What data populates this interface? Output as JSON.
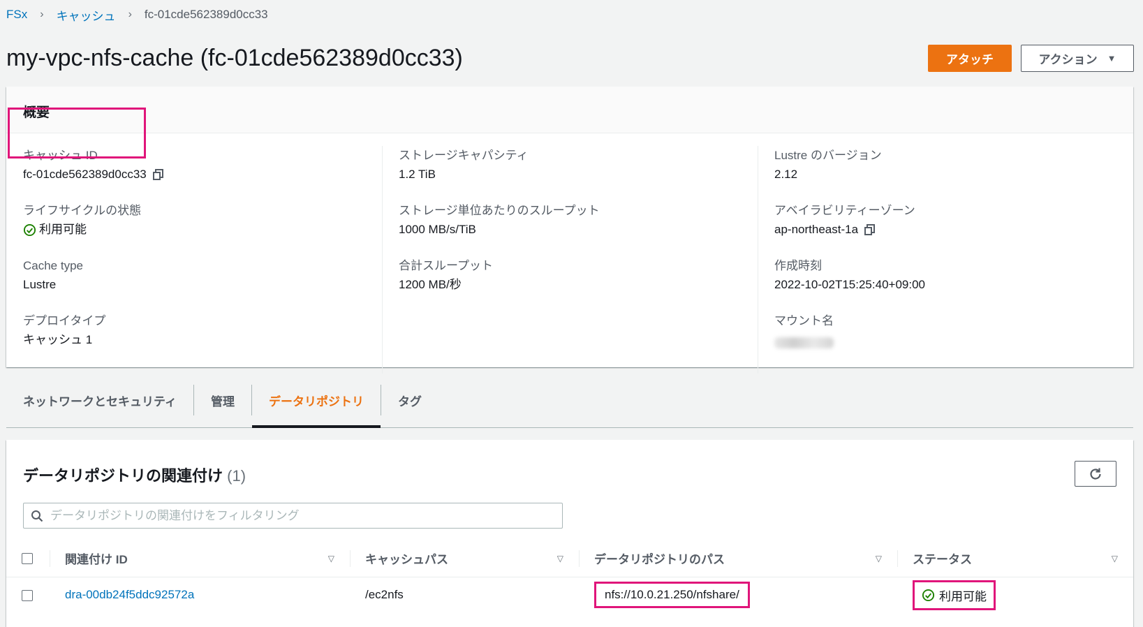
{
  "breadcrumb": {
    "items": [
      "FSx",
      "キャッシュ"
    ],
    "current": "fc-01cde562389d0cc33"
  },
  "page": {
    "title": "my-vpc-nfs-cache (fc-01cde562389d0cc33)"
  },
  "actions": {
    "attach_label": "アタッチ",
    "action_label": "アクション"
  },
  "summary": {
    "header": "概要",
    "col1": {
      "cache_id_label": "キャッシュ ID",
      "cache_id_value": "fc-01cde562389d0cc33",
      "lifecycle_label": "ライフサイクルの状態",
      "lifecycle_value": "利用可能",
      "cache_type_label": "Cache type",
      "cache_type_value": "Lustre",
      "deploy_label": "デプロイタイプ",
      "deploy_value": "キャッシュ 1"
    },
    "col2": {
      "storage_label": "ストレージキャパシティ",
      "storage_value": "1.2 TiB",
      "per_unit_label": "ストレージ単位あたりのスループット",
      "per_unit_value": "1000 MB/s/TiB",
      "total_label": "合計スループット",
      "total_value": "1200 MB/秒"
    },
    "col3": {
      "lustre_label": "Lustre のバージョン",
      "lustre_value": "2.12",
      "az_label": "アベイラビリティーゾーン",
      "az_value": "ap-northeast-1a",
      "created_label": "作成時刻",
      "created_value": "2022-10-02T15:25:40+09:00",
      "mount_label": "マウント名"
    }
  },
  "tabs": [
    "ネットワークとセキュリティ",
    "管理",
    "データリポジトリ",
    "タグ"
  ],
  "assoc": {
    "title": "データリポジトリの関連付け",
    "count": "(1)",
    "filter_placeholder": "データリポジトリの関連付けをフィルタリング",
    "columns": [
      "関連付け ID",
      "キャッシュパス",
      "データリポジトリのパス",
      "ステータス"
    ],
    "rows": [
      {
        "id": "dra-00db24f5ddc92572a",
        "cache_path": "/ec2nfs",
        "repo_path": "nfs://10.0.21.250/nfshare/",
        "status": "利用可能"
      }
    ]
  },
  "colors": {
    "accent": "#ec7211",
    "link": "#0073bb",
    "success": "#1d8102",
    "highlight": "#e0157a"
  }
}
